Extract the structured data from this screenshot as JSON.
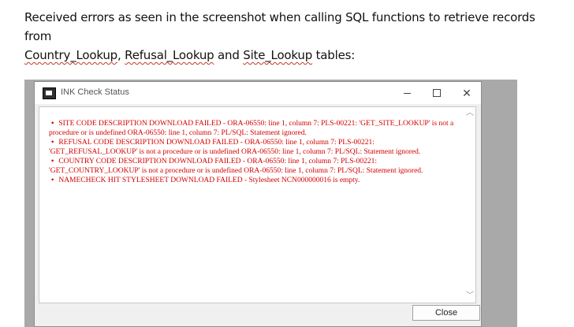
{
  "intro": {
    "line1": "Received errors as seen in the screenshot when calling SQL functions to retrieve records from",
    "t1": "Country_Lookup",
    "sep1": ", ",
    "t2": "Refusal_Lookup",
    "sep2": " and ",
    "t3": "Site_Lookup",
    "tail": " tables:"
  },
  "window": {
    "title": "INK Check Status",
    "icons": {
      "app": "app-icon",
      "minimize": "minimize-icon",
      "maximize": "maximize-icon",
      "close": "close-icon"
    },
    "close_glyph": "✕",
    "close_button_label": "Close"
  },
  "errors": [
    "SITE CODE DESCRIPTION DOWNLOAD FAILED - ORA-06550: line 1, column 7: PLS-00221: 'GET_SITE_LOOKUP' is not a procedure or is undefined ORA-06550: line 1, column 7: PL/SQL: Statement ignored.",
    "REFUSAL CODE DESCRIPTION DOWNLOAD FAILED - ORA-06550: line 1, column 7: PLS-00221: 'GET_REFUSAL_LOOKUP' is not a procedure or is undefined ORA-06550: line 1, column 7: PL/SQL: Statement ignored.",
    "COUNTRY CODE DESCRIPTION DOWNLOAD FAILED - ORA-06550: line 1, column 7: PLS-00221: 'GET_COUNTRY_LOOKUP' is not a procedure or is undefined ORA-06550: line 1, column 7: PL/SQL: Statement ignored.",
    "NAMECHECK HIT STYLESHEET DOWNLOAD FAILED - Stylesheet NCN000000016 is empty."
  ],
  "bullet": "•",
  "error_color": "#d40000"
}
